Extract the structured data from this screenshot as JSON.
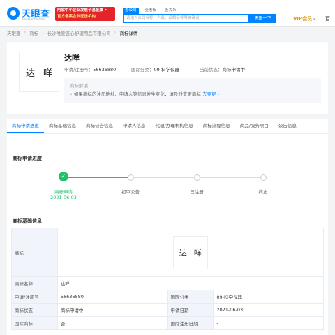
{
  "header": {
    "logo_title": "天眼查",
    "logo_sub": "TianYanCha.com",
    "promo_line1": "阿家中小企业发展子基金旗下",
    "promo_line2": "官方备案企业征信机构",
    "search_tabs": [
      "查公司",
      "查老板",
      "查关系"
    ],
    "search_placeholder": "请输入公司名称、人名、品牌名称等关键词",
    "search_button": "天眼一下",
    "vip_label": "VIP会员",
    "vip_caret": "▾",
    "right_text": "百"
  },
  "breadcrumb": {
    "items": [
      "天眼查",
      "商标",
      "长沙唯爱匠心护理用品有限公司",
      "商标详情"
    ],
    "separator": "›"
  },
  "trademark": {
    "thumb_chars": [
      "达",
      "咩"
    ],
    "name": "达咩",
    "reg_no_label": "申请/注册号：",
    "reg_no": "56636880",
    "class_label": "国际分类：",
    "class_value": "09-科学仪器",
    "status_label": "当前状态：",
    "status_value": "商标申请中",
    "tip_title": "商标解读：",
    "tip_text": "• 如果商标的注册地址、申请人等信息发生变化，请及时变更商标",
    "tip_link": "去变更 ›"
  },
  "tabs": [
    "商标申请进度",
    "商标基础信息",
    "商标公告信息",
    "申请人信息",
    "代理/办理机构信息",
    "商标流程信息",
    "商品/服务项目",
    "公告信息"
  ],
  "progress": {
    "title": "商标申请进度",
    "steps": [
      {
        "label": "商标申请",
        "date": "2021-06-03",
        "done": true
      },
      {
        "label": "初审公告",
        "done": false
      },
      {
        "label": "已注册",
        "done": false
      },
      {
        "label": "终止",
        "done": false
      }
    ],
    "check_glyph": "✓"
  },
  "basic_info": {
    "title": "商标基础信息",
    "image_label": "商标",
    "image_chars": [
      "达",
      "咩"
    ],
    "rows": [
      {
        "k1": "商标名称",
        "v1": "达咩"
      },
      {
        "k1": "申请/注册号",
        "v1": "56636880",
        "k2": "国际分类",
        "v2": "09-科学仪器"
      },
      {
        "k1": "商标状态",
        "v1": "商标申请中",
        "k2": "申请日期",
        "v2": "2021-06-03"
      },
      {
        "k1": "国际商标",
        "v1": "否",
        "k2": "国际注册日期",
        "v2": "-"
      }
    ]
  },
  "colors": {
    "brand": "#0084ff",
    "success": "#20c06d",
    "promo": "#e4232a",
    "vip": "#e09b25"
  }
}
